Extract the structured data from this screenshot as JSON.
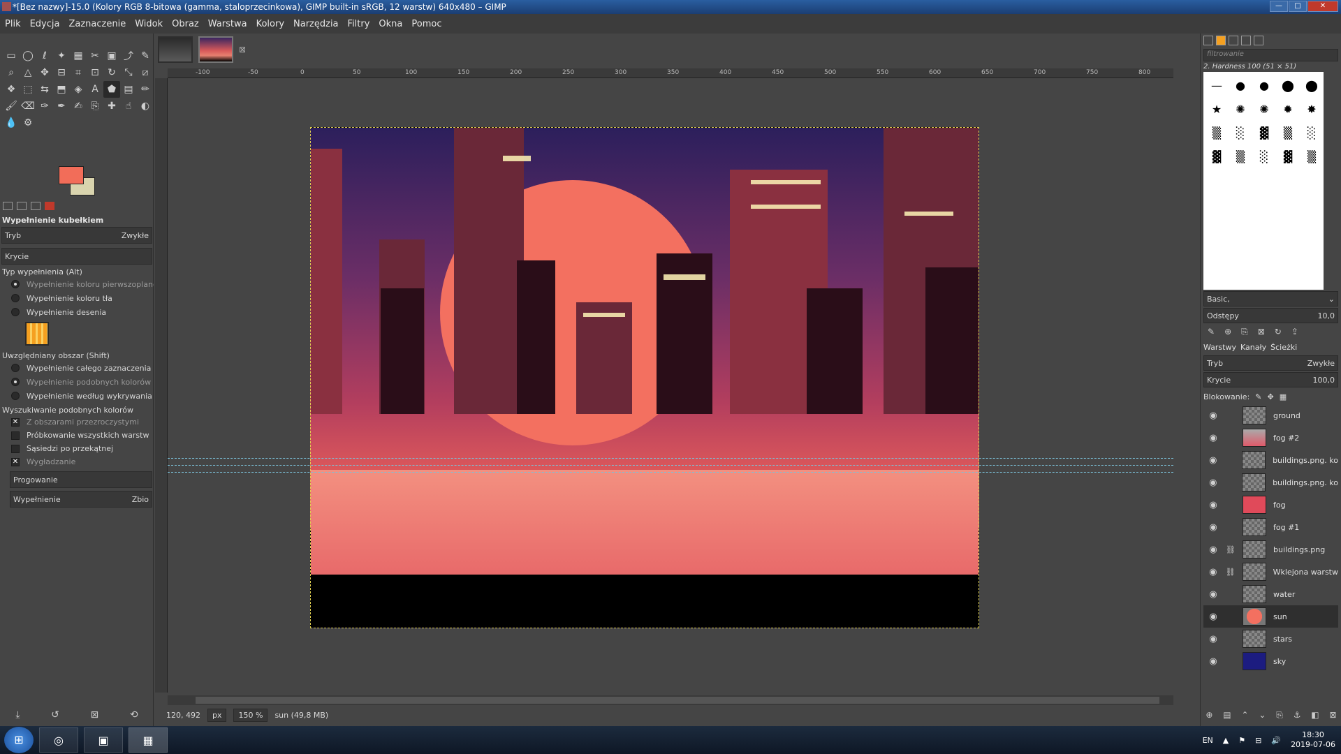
{
  "window": {
    "title": "*[Bez nazwy]-15.0 (Kolory RGB 8-bitowa (gamma, staloprzecinkowa), GIMP built-in sRGB, 12 warstw) 640x480 – GIMP"
  },
  "menu": [
    "Plik",
    "Edycja",
    "Zaznaczenie",
    "Widok",
    "Obraz",
    "Warstwa",
    "Kolory",
    "Narzędzia",
    "Filtry",
    "Okna",
    "Pomoc"
  ],
  "tool_options": {
    "title": "Wypełnienie kubełkiem",
    "mode_label": "Tryb",
    "mode_value": "Zwykłe",
    "opacity_label": "Krycie",
    "fill_type_label": "Typ wypełnienia  (Alt)",
    "fill_fg": "Wypełnienie koloru pierwszoplanowego",
    "fill_bg": "Wypełnienie koloru tła",
    "fill_pattern": "Wypełnienie desenia",
    "area_label": "Uwzględniany obszar  (Shift)",
    "area_whole": "Wypełnienie całego zaznaczenia",
    "area_similar": "Wypełnienie podobnych kolorów",
    "area_lineart": "Wypełnienie według wykrywania kreski",
    "similar_label": "Wyszukiwanie podobnych kolorów",
    "opt_transparent": "Z obszarami przezroczystymi",
    "opt_sample_merged": "Próbkowanie wszystkich warstw",
    "opt_diagonal": "Sąsiedzi po przekątnej",
    "opt_antialias": "Wygładzanie",
    "threshold_label": "Progowanie",
    "fill_by_label": "Wypełnienie",
    "fill_by_value": "Zbio"
  },
  "colors": {
    "foreground": "#f26d59",
    "background": "#d9d4ae",
    "accent": "#c0392b"
  },
  "ruler": [
    "-100",
    "-50",
    "0",
    "50",
    "100",
    "150",
    "200",
    "250",
    "300",
    "350",
    "400",
    "450",
    "500",
    "550",
    "600",
    "650",
    "700",
    "750",
    "800"
  ],
  "status": {
    "coords": "120, 492",
    "unit": "px",
    "zoom": "150 %",
    "layer_info": "sun (49,8 MB)"
  },
  "dock": {
    "filter_placeholder": "filtrowanie",
    "brush_name": "2. Hardness 100 (51 × 51)",
    "brush_preset": "Basic,",
    "spacing_label": "Odstępy",
    "spacing_value": "10,0",
    "tab_layers": "Warstwy",
    "tab_channels": "Kanały",
    "tab_paths": "Ścieżki",
    "mode_label": "Tryb",
    "mode_value": "Zwykłe",
    "opacity_label": "Krycie",
    "opacity_value": "100,0",
    "lock_label": "Blokowanie:"
  },
  "layers": [
    {
      "name": "ground",
      "chain": false,
      "selected": false
    },
    {
      "name": "fog #2",
      "chain": false,
      "selected": false
    },
    {
      "name": "buildings.png. ko",
      "chain": false,
      "selected": false
    },
    {
      "name": "buildings.png. ko",
      "chain": false,
      "selected": false
    },
    {
      "name": "fog",
      "chain": false,
      "selected": false
    },
    {
      "name": "fog #1",
      "chain": false,
      "selected": false
    },
    {
      "name": "buildings.png",
      "chain": true,
      "selected": false
    },
    {
      "name": "Wklejona warstw",
      "chain": true,
      "selected": false
    },
    {
      "name": "water",
      "chain": false,
      "selected": false
    },
    {
      "name": "sun",
      "chain": false,
      "selected": true
    },
    {
      "name": "stars",
      "chain": false,
      "selected": false
    },
    {
      "name": "sky",
      "chain": false,
      "selected": false
    }
  ],
  "taskbar": {
    "lang": "EN",
    "time": "18:30",
    "date": "2019-07-06"
  }
}
